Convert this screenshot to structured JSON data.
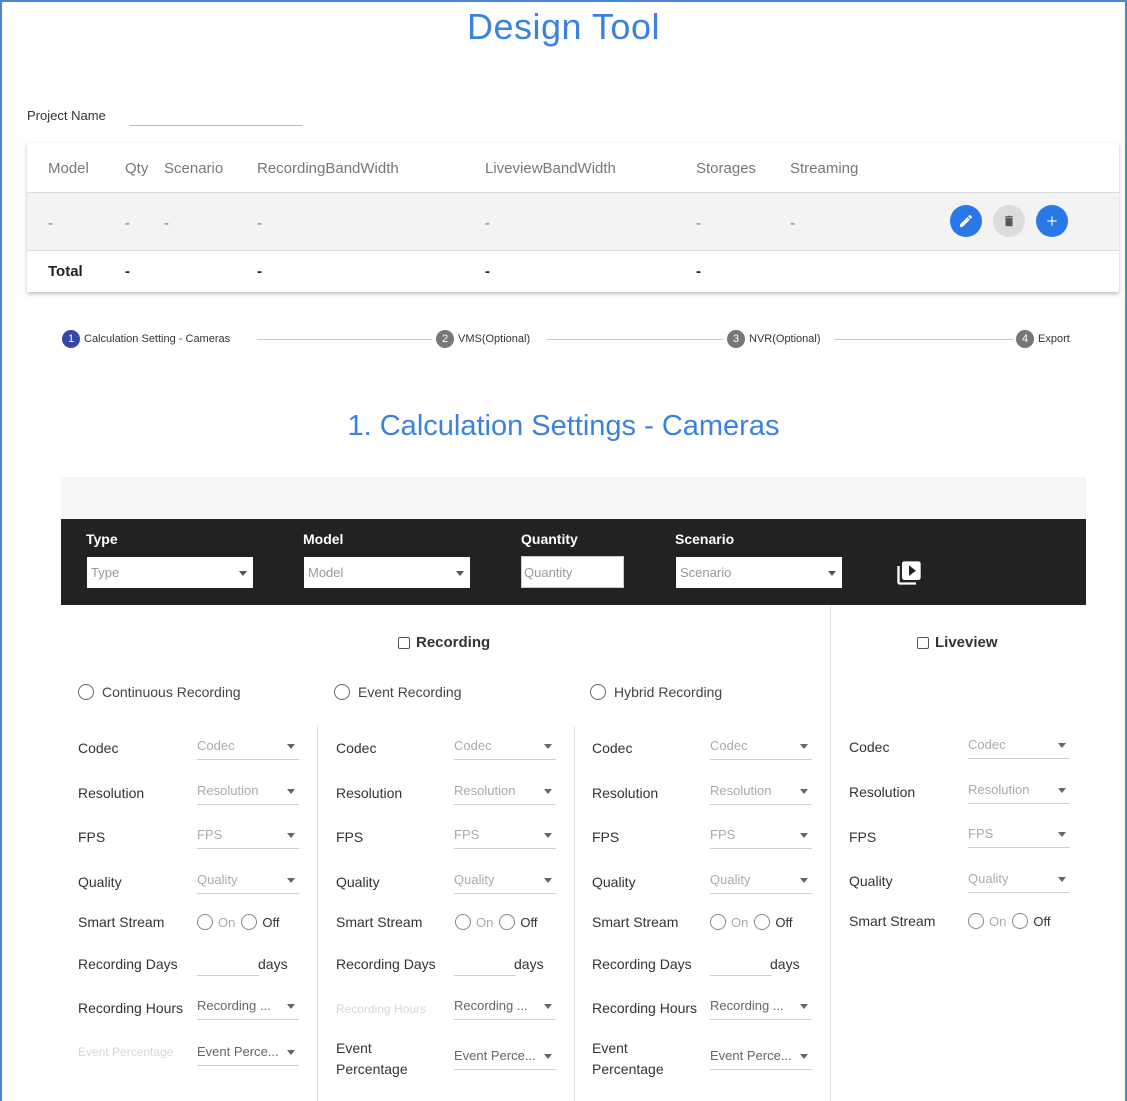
{
  "app": {
    "title": "Design Tool"
  },
  "project": {
    "label": "Project Name",
    "value": ""
  },
  "summary": {
    "headers": [
      "Model",
      "Qty",
      "Scenario",
      "RecordingBandWidth",
      "LiveviewBandWidth",
      "Storages",
      "Streaming"
    ],
    "row": [
      "-",
      "-",
      "-",
      "-",
      "-",
      "-",
      "-"
    ],
    "total": {
      "label": "Total",
      "qty": "-",
      "recording": "-",
      "liveview": "-",
      "storages": "-"
    }
  },
  "stepper": {
    "steps": [
      {
        "num": "1",
        "label": "Calculation Setting - Cameras"
      },
      {
        "num": "2",
        "label": "VMS(Optional)"
      },
      {
        "num": "3",
        "label": "NVR(Optional)"
      },
      {
        "num": "4",
        "label": "Export"
      }
    ]
  },
  "section": {
    "title": "1. Calculation Settings - Cameras"
  },
  "filters": {
    "type": {
      "label": "Type",
      "placeholder": "Type"
    },
    "model": {
      "label": "Model",
      "placeholder": "Model"
    },
    "quantity": {
      "label": "Quantity",
      "placeholder": "Quantity"
    },
    "scenario": {
      "label": "Scenario",
      "placeholder": "Scenario"
    }
  },
  "recording": {
    "label": "Recording",
    "modes": [
      "Continuous Recording",
      "Event Recording",
      "Hybrid Recording"
    ],
    "columns": [
      {
        "codec": "Codec",
        "resolution": "Resolution",
        "fps": "FPS",
        "quality": "Quality",
        "smart_stream": "Smart Stream",
        "on": "On",
        "off": "Off",
        "days_label": "Recording Days",
        "days_unit": "days",
        "hours_label": "Recording Hours",
        "hours_value": "Recording ...",
        "event_label": "Event Percentage",
        "event_value": "Event Perce..."
      },
      {
        "codec": "Codec",
        "resolution": "Resolution",
        "fps": "FPS",
        "quality": "Quality",
        "smart_stream": "Smart Stream",
        "on": "On",
        "off": "Off",
        "days_label": "Recording Days",
        "days_unit": "days",
        "hours_label": "Recording Hours",
        "hours_value": "Recording ...",
        "event_label_1": "Event",
        "event_label_2": "Percentage",
        "event_value": "Event Perce..."
      },
      {
        "codec": "Codec",
        "resolution": "Resolution",
        "fps": "FPS",
        "quality": "Quality",
        "smart_stream": "Smart Stream",
        "on": "On",
        "off": "Off",
        "days_label": "Recording Days",
        "days_unit": "days",
        "hours_label": "Recording Hours",
        "hours_value": "Recording ...",
        "event_label_1": "Event",
        "event_label_2": "Percentage",
        "event_value": "Event Perce..."
      }
    ]
  },
  "liveview": {
    "label": "Liveview",
    "codec": "Codec",
    "resolution": "Resolution",
    "fps": "FPS",
    "quality": "Quality",
    "smart_stream": "Smart Stream",
    "on": "On",
    "off": "Off"
  }
}
